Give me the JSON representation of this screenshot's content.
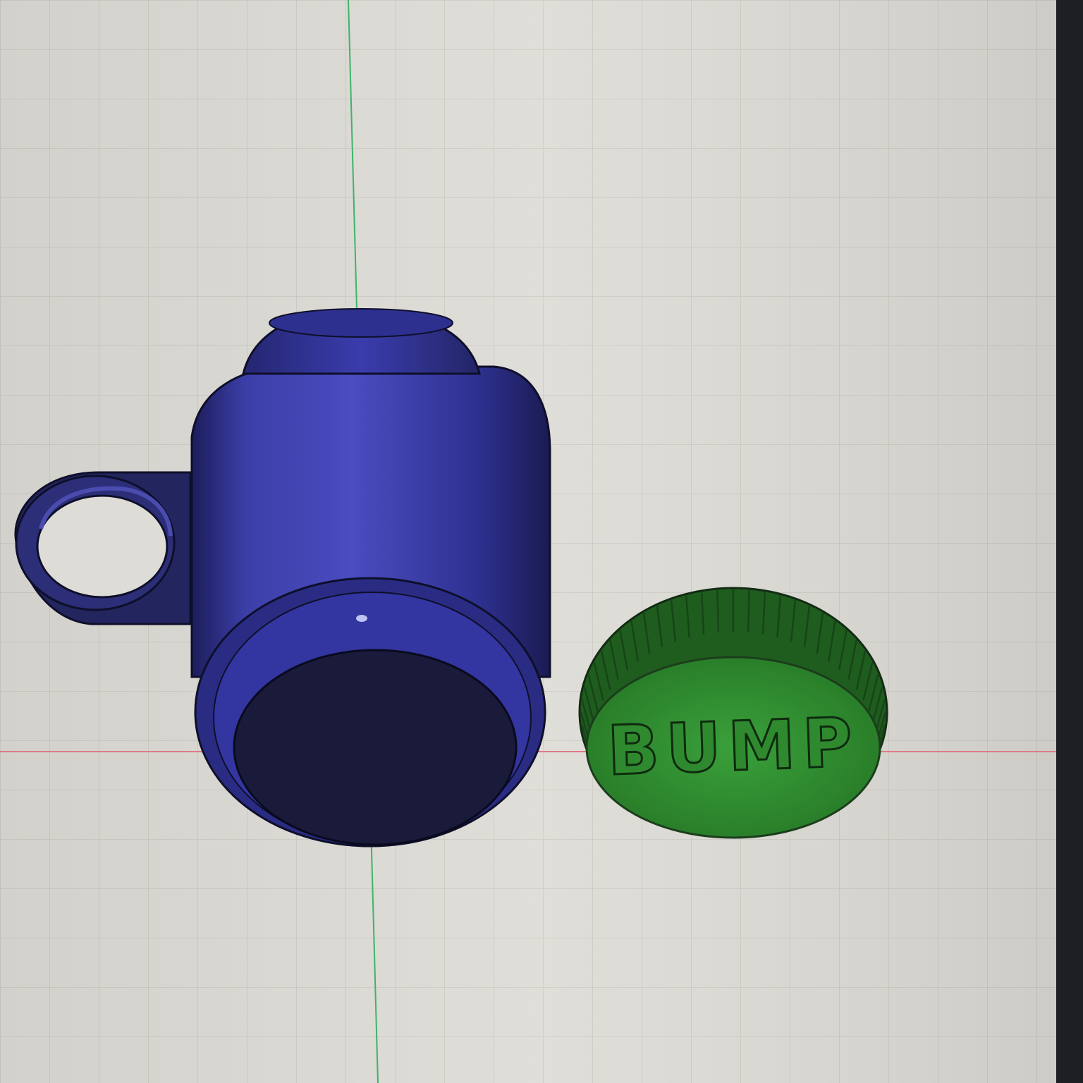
{
  "viewport": {
    "background": "#dedcd6",
    "grid_color": "#c8c6c0",
    "axis_x_color": "#e07a86",
    "axis_y_color": "#3fb36a"
  },
  "models": {
    "container": {
      "color": "#2f3090",
      "dark_face": "#1a1a3a"
    },
    "cap": {
      "color": "#2f8a2f",
      "edge": "#1c3e1c",
      "label": "BUMP"
    }
  }
}
